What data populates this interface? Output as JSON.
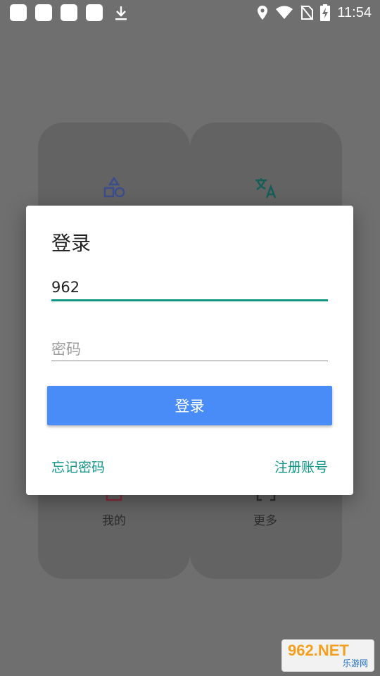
{
  "status_bar": {
    "notification_icons": [
      "app-icon",
      "app-icon",
      "app-icon",
      "app-icon",
      "download-icon"
    ],
    "indicators": [
      "location-icon",
      "wifi-icon",
      "no-sim-icon",
      "battery-charging-icon"
    ],
    "time": "11:54"
  },
  "background_menu": {
    "items": [
      {
        "label": "",
        "icon": "shapes-icon"
      },
      {
        "label": "",
        "icon": "translate-icon"
      },
      {
        "label": "我的",
        "icon": "user-icon"
      },
      {
        "label": "更多",
        "icon": "expand-icon"
      }
    ]
  },
  "dialog": {
    "title": "登录",
    "username_value": "962",
    "password_placeholder": "密码",
    "login_button": "登录",
    "forgot_password": "忘记密码",
    "register": "注册账号"
  },
  "watermark": {
    "brand": "962.NET",
    "sub": "乐游网"
  },
  "colors": {
    "accent": "#119688",
    "button": "#4a8cf7",
    "overlay": "#6f6f6f"
  }
}
